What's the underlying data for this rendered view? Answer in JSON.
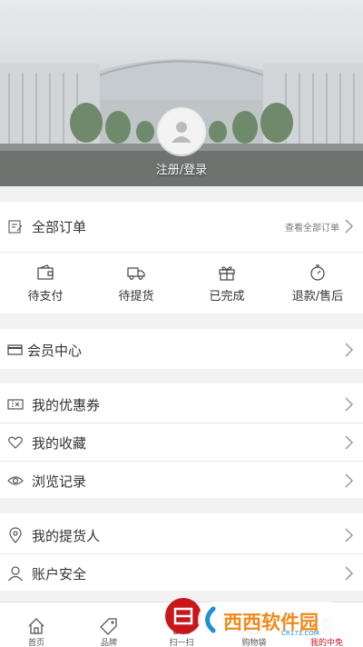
{
  "header": {
    "login_text": "注册/登录"
  },
  "orders": {
    "title": "全部订单",
    "view_all": "查看全部订单",
    "statuses": [
      {
        "label": "待支付",
        "icon": "wallet-icon"
      },
      {
        "label": "待提货",
        "icon": "truck-icon"
      },
      {
        "label": "已完成",
        "icon": "gift-icon"
      },
      {
        "label": "退款/售后",
        "icon": "refund-icon"
      }
    ]
  },
  "menu": {
    "member_center": "会员中心",
    "coupons": "我的优惠券",
    "favorites": "我的收藏",
    "history": "浏览记录",
    "pickup_person": "我的提货人",
    "account_security": "账户安全"
  },
  "tabbar": {
    "items": [
      {
        "label": "首页",
        "icon": "home-icon"
      },
      {
        "label": "品牌",
        "icon": "tag-icon"
      },
      {
        "label": "扫一扫",
        "icon": "scan-icon"
      },
      {
        "label": "购物袋",
        "icon": "bag-icon"
      },
      {
        "label": "我的中免",
        "icon": "user-icon"
      }
    ],
    "active_index": 4
  },
  "watermark": {
    "text": "西西软件园",
    "subtext": "CR173.COM"
  },
  "colors": {
    "accent": "#c8161d",
    "page_bg": "#f2f2f2"
  }
}
